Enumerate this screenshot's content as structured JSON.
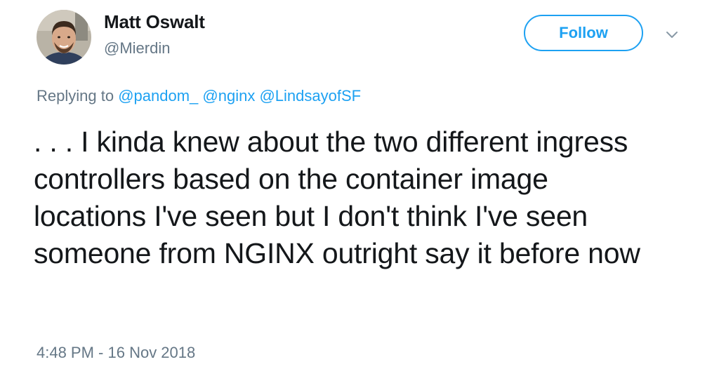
{
  "author": {
    "display_name": "Matt Oswalt",
    "handle": "@Mierdin"
  },
  "follow_button": {
    "label": "Follow"
  },
  "reply": {
    "prefix": "Replying to",
    "mentions": [
      "@pandom_",
      "@nginx",
      "@LindsayofSF"
    ]
  },
  "tweet": {
    "text": ". . . I kinda knew about the two different ingress controllers based on the container image locations I've seen but I don't think I've seen someone from NGINX outright say it before now",
    "timestamp": "4:48 PM - 16 Nov 2018"
  },
  "colors": {
    "accent": "#1da1f2",
    "secondary_text": "#657786",
    "primary_text": "#14171a"
  },
  "icons": {
    "menu": "chevron-down-icon",
    "avatar": "avatar"
  }
}
